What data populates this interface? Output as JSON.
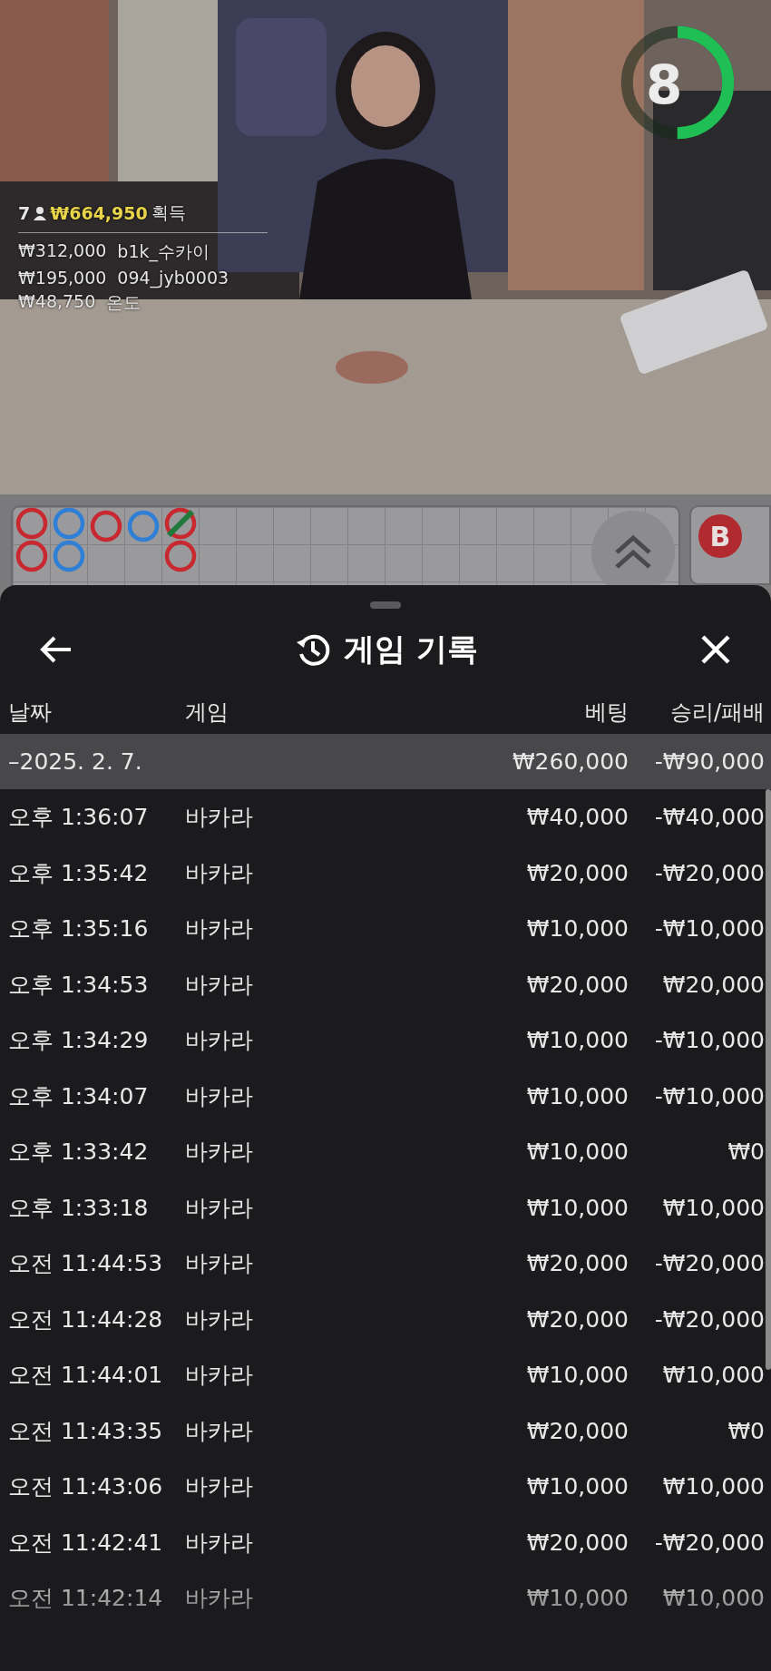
{
  "video": {
    "kind": "picture",
    "timer": {
      "text": "8",
      "level": 0.5
    },
    "winners": {
      "count": "7",
      "total": "₩664,950",
      "label": "획득",
      "list": [
        {
          "amount": "₩312,000",
          "name": "b1k_수카이"
        },
        {
          "amount": "₩195,000",
          "name": "094_jyb0003"
        },
        {
          "amount": "₩48,750",
          "name": "온도"
        }
      ]
    }
  },
  "road": {
    "columns": [
      [
        {
          "color": "#c8282f",
          "tie": false
        },
        {
          "color": "#c8282f",
          "tie": false
        }
      ],
      [
        {
          "color": "#2f7fd6",
          "tie": false
        },
        {
          "color": "#2f7fd6",
          "tie": false
        }
      ],
      [
        {
          "color": "#c8282f",
          "tie": false
        }
      ],
      [
        {
          "color": "#2f7fd6",
          "tie": false
        }
      ],
      [
        {
          "color": "#c8282f",
          "tie": true
        },
        {
          "color": "#c8282f",
          "tie": false
        }
      ]
    ],
    "side_badge": "B"
  },
  "sheet": {
    "title": "게임 기록",
    "columns": [
      "날짜",
      "게임",
      "베팅",
      "승리/패배"
    ],
    "summary": {
      "date": "–2025. 2. 7.",
      "bet": "₩260,000",
      "result": "-₩90,000"
    },
    "rows": [
      {
        "time": "오후 1:36:07",
        "game": "바카라",
        "bet": "₩40,000",
        "result": "-₩40,000"
      },
      {
        "time": "오후 1:35:42",
        "game": "바카라",
        "bet": "₩20,000",
        "result": "-₩20,000"
      },
      {
        "time": "오후 1:35:16",
        "game": "바카라",
        "bet": "₩10,000",
        "result": "-₩10,000"
      },
      {
        "time": "오후 1:34:53",
        "game": "바카라",
        "bet": "₩20,000",
        "result": "₩20,000"
      },
      {
        "time": "오후 1:34:29",
        "game": "바카라",
        "bet": "₩10,000",
        "result": "-₩10,000"
      },
      {
        "time": "오후 1:34:07",
        "game": "바카라",
        "bet": "₩10,000",
        "result": "-₩10,000"
      },
      {
        "time": "오후 1:33:42",
        "game": "바카라",
        "bet": "₩10,000",
        "result": "₩0"
      },
      {
        "time": "오후 1:33:18",
        "game": "바카라",
        "bet": "₩10,000",
        "result": "₩10,000"
      },
      {
        "time": "오전 11:44:53",
        "game": "바카라",
        "bet": "₩20,000",
        "result": "-₩20,000"
      },
      {
        "time": "오전 11:44:28",
        "game": "바카라",
        "bet": "₩20,000",
        "result": "-₩20,000"
      },
      {
        "time": "오전 11:44:01",
        "game": "바카라",
        "bet": "₩10,000",
        "result": "₩10,000"
      },
      {
        "time": "오전 11:43:35",
        "game": "바카라",
        "bet": "₩20,000",
        "result": "₩0"
      },
      {
        "time": "오전 11:43:06",
        "game": "바카라",
        "bet": "₩10,000",
        "result": "₩10,000"
      },
      {
        "time": "오전 11:42:41",
        "game": "바카라",
        "bet": "₩20,000",
        "result": "-₩20,000"
      },
      {
        "time": "오전 11:42:14",
        "game": "바카라",
        "bet": "₩10,000",
        "result": "₩10,000"
      }
    ]
  }
}
